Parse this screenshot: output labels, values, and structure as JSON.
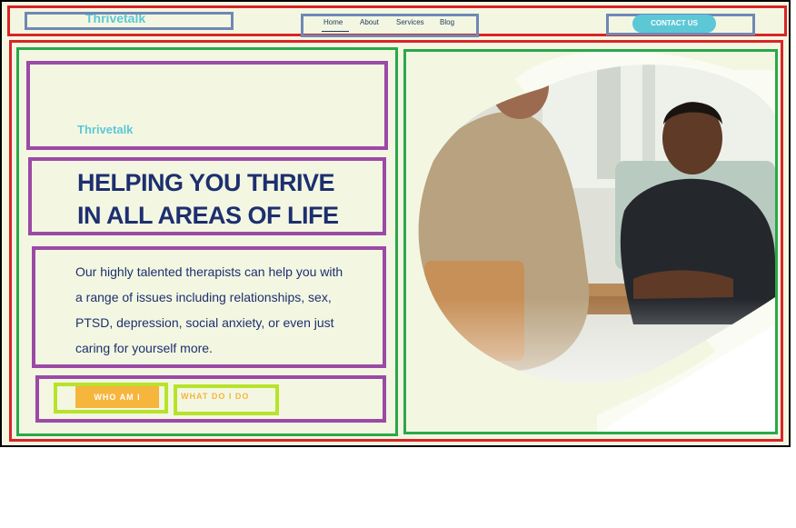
{
  "header": {
    "logo": "Thrivetalk",
    "nav": [
      "Home",
      "About",
      "Services",
      "Blog"
    ],
    "active_nav": "Home",
    "contact_label": "CONTACT US"
  },
  "hero": {
    "eyebrow": "Thrivetalk",
    "headline_line1": "HELPING YOU THRIVE",
    "headline_line2": "IN ALL AREAS OF LIFE",
    "body": "Our highly talented therapists can help you with a range of issues including relationships, sex, PTSD, depression, social anxiety, or even just caring for yourself more.",
    "btn_primary": "WHO AM I",
    "btn_secondary": "WHAT DO I DO"
  },
  "colors": {
    "brand": "#5cc8d6",
    "heading": "#1d2f6f",
    "accent": "#f6b53d",
    "background": "#f3f7e2"
  }
}
